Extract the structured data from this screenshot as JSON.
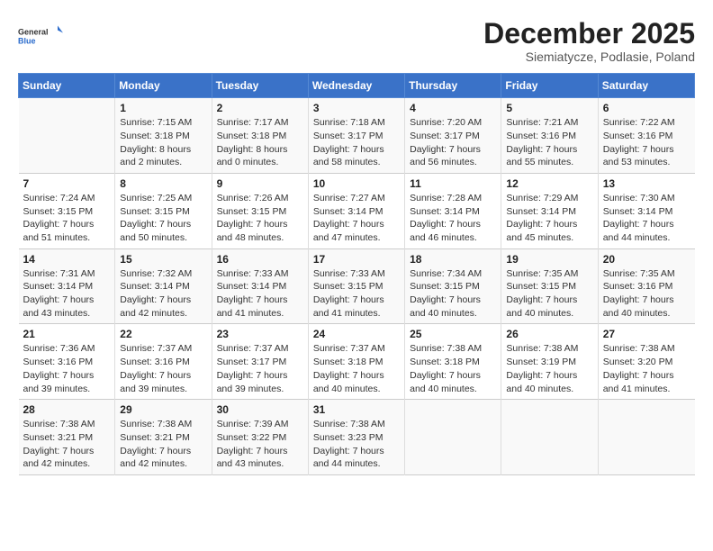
{
  "logo": {
    "general": "General",
    "blue": "Blue"
  },
  "title": "December 2025",
  "subtitle": "Siemiatycze, Podlasie, Poland",
  "days_header": [
    "Sunday",
    "Monday",
    "Tuesday",
    "Wednesday",
    "Thursday",
    "Friday",
    "Saturday"
  ],
  "weeks": [
    [
      {
        "day": "",
        "info": ""
      },
      {
        "day": "1",
        "info": "Sunrise: 7:15 AM\nSunset: 3:18 PM\nDaylight: 8 hours\nand 2 minutes."
      },
      {
        "day": "2",
        "info": "Sunrise: 7:17 AM\nSunset: 3:18 PM\nDaylight: 8 hours\nand 0 minutes."
      },
      {
        "day": "3",
        "info": "Sunrise: 7:18 AM\nSunset: 3:17 PM\nDaylight: 7 hours\nand 58 minutes."
      },
      {
        "day": "4",
        "info": "Sunrise: 7:20 AM\nSunset: 3:17 PM\nDaylight: 7 hours\nand 56 minutes."
      },
      {
        "day": "5",
        "info": "Sunrise: 7:21 AM\nSunset: 3:16 PM\nDaylight: 7 hours\nand 55 minutes."
      },
      {
        "day": "6",
        "info": "Sunrise: 7:22 AM\nSunset: 3:16 PM\nDaylight: 7 hours\nand 53 minutes."
      }
    ],
    [
      {
        "day": "7",
        "info": "Sunrise: 7:24 AM\nSunset: 3:15 PM\nDaylight: 7 hours\nand 51 minutes."
      },
      {
        "day": "8",
        "info": "Sunrise: 7:25 AM\nSunset: 3:15 PM\nDaylight: 7 hours\nand 50 minutes."
      },
      {
        "day": "9",
        "info": "Sunrise: 7:26 AM\nSunset: 3:15 PM\nDaylight: 7 hours\nand 48 minutes."
      },
      {
        "day": "10",
        "info": "Sunrise: 7:27 AM\nSunset: 3:14 PM\nDaylight: 7 hours\nand 47 minutes."
      },
      {
        "day": "11",
        "info": "Sunrise: 7:28 AM\nSunset: 3:14 PM\nDaylight: 7 hours\nand 46 minutes."
      },
      {
        "day": "12",
        "info": "Sunrise: 7:29 AM\nSunset: 3:14 PM\nDaylight: 7 hours\nand 45 minutes."
      },
      {
        "day": "13",
        "info": "Sunrise: 7:30 AM\nSunset: 3:14 PM\nDaylight: 7 hours\nand 44 minutes."
      }
    ],
    [
      {
        "day": "14",
        "info": "Sunrise: 7:31 AM\nSunset: 3:14 PM\nDaylight: 7 hours\nand 43 minutes."
      },
      {
        "day": "15",
        "info": "Sunrise: 7:32 AM\nSunset: 3:14 PM\nDaylight: 7 hours\nand 42 minutes."
      },
      {
        "day": "16",
        "info": "Sunrise: 7:33 AM\nSunset: 3:14 PM\nDaylight: 7 hours\nand 41 minutes."
      },
      {
        "day": "17",
        "info": "Sunrise: 7:33 AM\nSunset: 3:15 PM\nDaylight: 7 hours\nand 41 minutes."
      },
      {
        "day": "18",
        "info": "Sunrise: 7:34 AM\nSunset: 3:15 PM\nDaylight: 7 hours\nand 40 minutes."
      },
      {
        "day": "19",
        "info": "Sunrise: 7:35 AM\nSunset: 3:15 PM\nDaylight: 7 hours\nand 40 minutes."
      },
      {
        "day": "20",
        "info": "Sunrise: 7:35 AM\nSunset: 3:16 PM\nDaylight: 7 hours\nand 40 minutes."
      }
    ],
    [
      {
        "day": "21",
        "info": "Sunrise: 7:36 AM\nSunset: 3:16 PM\nDaylight: 7 hours\nand 39 minutes."
      },
      {
        "day": "22",
        "info": "Sunrise: 7:37 AM\nSunset: 3:16 PM\nDaylight: 7 hours\nand 39 minutes."
      },
      {
        "day": "23",
        "info": "Sunrise: 7:37 AM\nSunset: 3:17 PM\nDaylight: 7 hours\nand 39 minutes."
      },
      {
        "day": "24",
        "info": "Sunrise: 7:37 AM\nSunset: 3:18 PM\nDaylight: 7 hours\nand 40 minutes."
      },
      {
        "day": "25",
        "info": "Sunrise: 7:38 AM\nSunset: 3:18 PM\nDaylight: 7 hours\nand 40 minutes."
      },
      {
        "day": "26",
        "info": "Sunrise: 7:38 AM\nSunset: 3:19 PM\nDaylight: 7 hours\nand 40 minutes."
      },
      {
        "day": "27",
        "info": "Sunrise: 7:38 AM\nSunset: 3:20 PM\nDaylight: 7 hours\nand 41 minutes."
      }
    ],
    [
      {
        "day": "28",
        "info": "Sunrise: 7:38 AM\nSunset: 3:21 PM\nDaylight: 7 hours\nand 42 minutes."
      },
      {
        "day": "29",
        "info": "Sunrise: 7:38 AM\nSunset: 3:21 PM\nDaylight: 7 hours\nand 42 minutes."
      },
      {
        "day": "30",
        "info": "Sunrise: 7:39 AM\nSunset: 3:22 PM\nDaylight: 7 hours\nand 43 minutes."
      },
      {
        "day": "31",
        "info": "Sunrise: 7:38 AM\nSunset: 3:23 PM\nDaylight: 7 hours\nand 44 minutes."
      },
      {
        "day": "",
        "info": ""
      },
      {
        "day": "",
        "info": ""
      },
      {
        "day": "",
        "info": ""
      }
    ]
  ]
}
